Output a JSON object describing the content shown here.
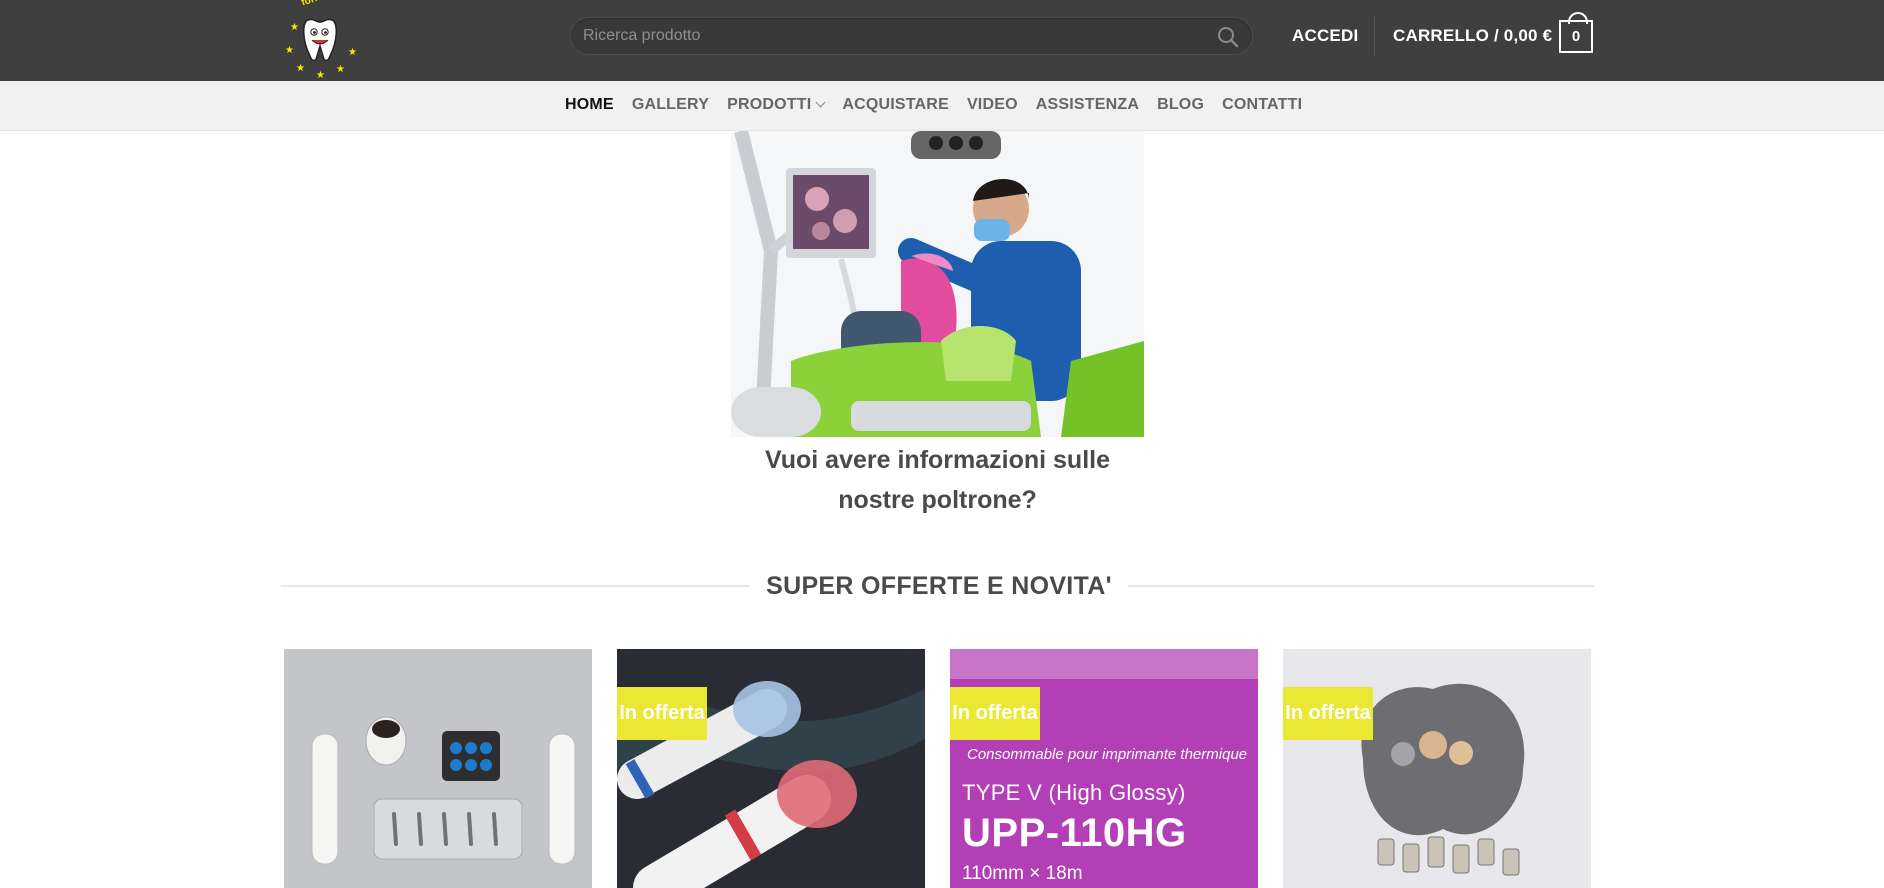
{
  "header": {
    "logo_text": "forniture dentali",
    "search_placeholder": "Ricerca prodotto",
    "login_label": "ACCEDI",
    "cart_label": "CARRELLO / 0,00 €",
    "cart_count": "0"
  },
  "nav": {
    "items": [
      {
        "label": "HOME",
        "active": true
      },
      {
        "label": "GALLERY"
      },
      {
        "label": "PRODOTTI",
        "has_dropdown": true
      },
      {
        "label": "ACQUISTARE"
      },
      {
        "label": "VIDEO"
      },
      {
        "label": "ASSISTENZA"
      },
      {
        "label": "BLOG"
      },
      {
        "label": "CONTATTI"
      }
    ]
  },
  "hero": {
    "cta_text": "Vuoi avere informazioni sulle nostre poltrone?"
  },
  "section": {
    "title": "SUPER OFFERTE E NOVITA'"
  },
  "products": [
    {
      "badge": ""
    },
    {
      "badge": "In offerta"
    },
    {
      "badge": "In offerta",
      "packaging_text": [
        "Consommable pour imprimante thermique",
        "TYPE V (High Glossy)",
        "UPP-110HG",
        "110mm × 18m"
      ]
    },
    {
      "badge": "In offerta"
    }
  ],
  "colors": {
    "header_bg": "#3f3f3f",
    "nav_bg": "#f1f1f1",
    "badge_bg": "#ebe833",
    "text_dark": "#4a4a4a"
  }
}
